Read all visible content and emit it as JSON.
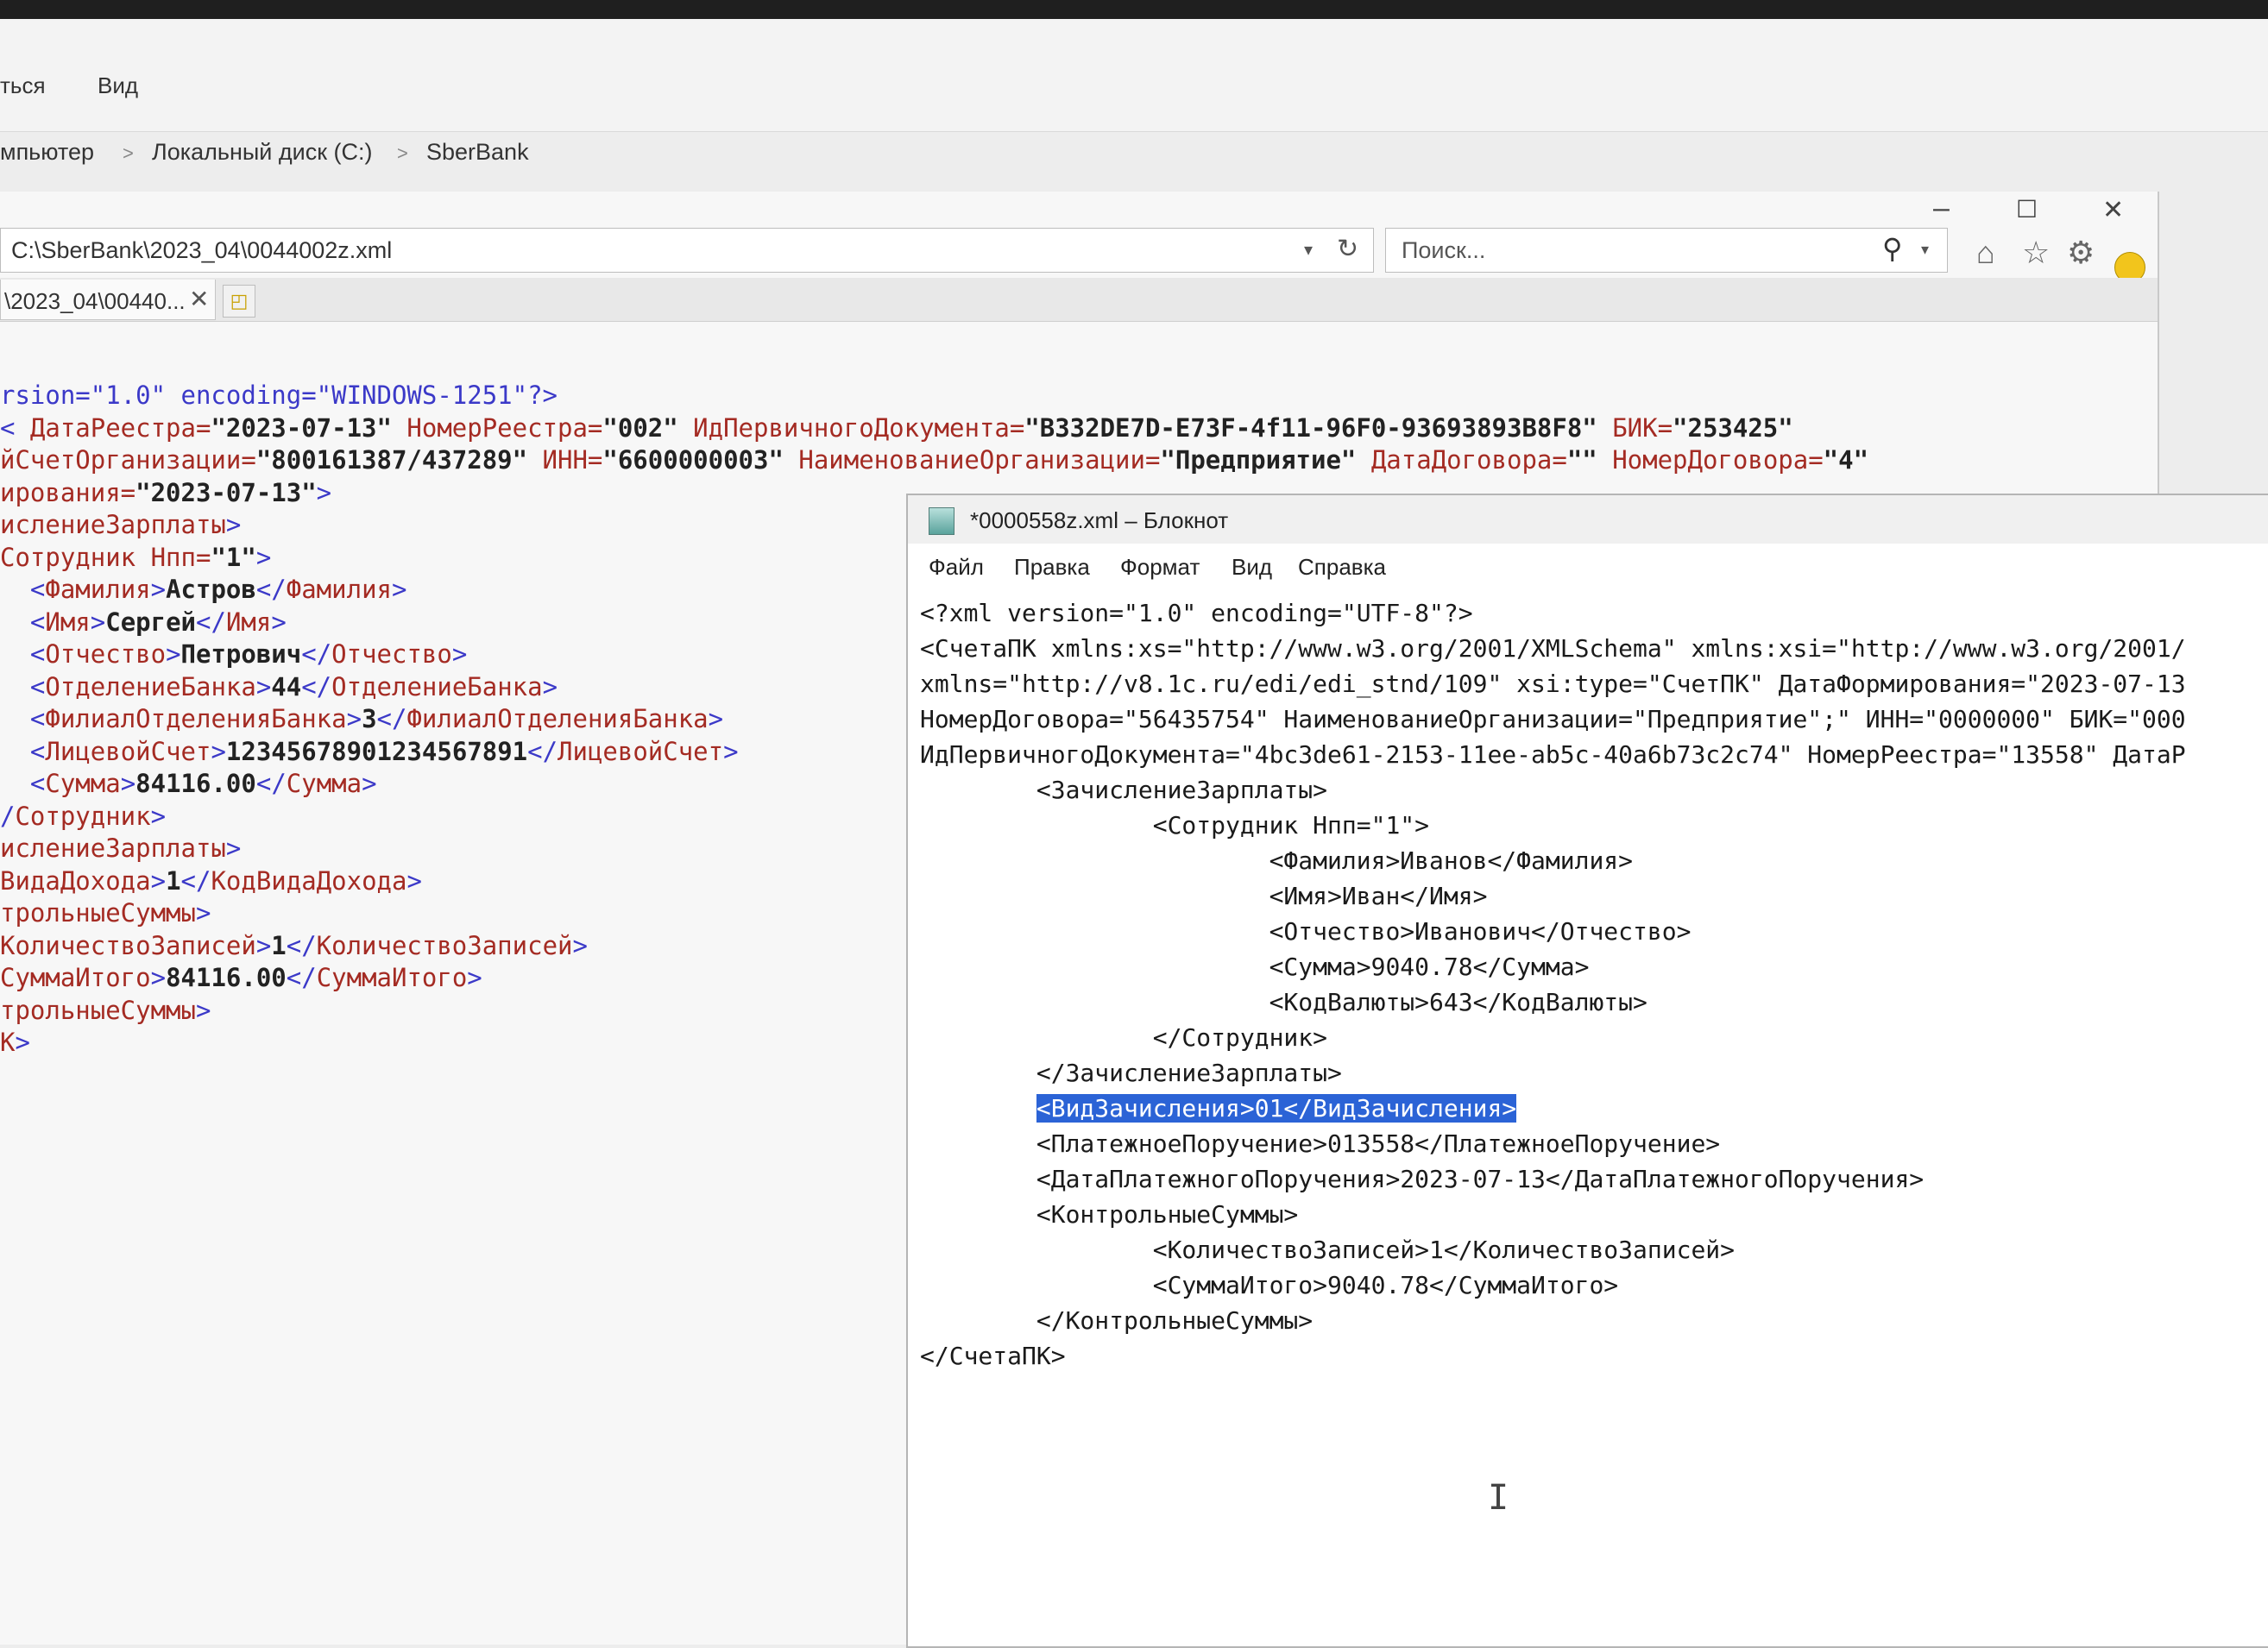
{
  "explorer": {
    "menu": [
      "ться",
      "Вид"
    ],
    "breadcrumb": [
      "мпьютер",
      "Локальный диск (C:)",
      "SberBank"
    ]
  },
  "ie": {
    "address": "C:\\SberBank\\2023_04\\0044002z.xml",
    "search_placeholder": "Поиск...",
    "tab_title": "\\2023_04\\00440...",
    "xml_lines": [
      [
        [
          "bl",
          "rsion=\"1.0\" encoding=\"WINDOWS-1251\"?>"
        ]
      ],
      [
        [
          "bl",
          "< "
        ],
        [
          "br",
          "ДатаРеестра="
        ],
        [
          "bk",
          "\"2023-07-13\" "
        ],
        [
          "br",
          "НомерРеестра="
        ],
        [
          "bk",
          "\"002\" "
        ],
        [
          "br",
          "ИдПервичногоДокумента="
        ],
        [
          "bk",
          "\"B332DE7D-E73F-4f11-96F0-93693893B8F8\" "
        ],
        [
          "br",
          "БИК="
        ],
        [
          "bk",
          "\"253425\""
        ]
      ],
      [
        [
          "br",
          "йСчетОрганизации="
        ],
        [
          "bk",
          "\"800161387/437289\" "
        ],
        [
          "br",
          "ИНН="
        ],
        [
          "bk",
          "\"6600000003\" "
        ],
        [
          "br",
          "НаименованиеОрганизации="
        ],
        [
          "bk",
          "\"Предприятие\" "
        ],
        [
          "br",
          "ДатаДоговора="
        ],
        [
          "bk",
          "\"\" "
        ],
        [
          "br",
          "НомерДоговора="
        ],
        [
          "bk",
          "\"4\""
        ]
      ],
      [
        [
          "br",
          "ирования="
        ],
        [
          "bk",
          "\"2023-07-13\""
        ],
        [
          "bl",
          ">"
        ]
      ],
      [
        [
          "br",
          "исление3арплаты"
        ],
        [
          "bl",
          ">"
        ]
      ],
      [
        [
          "br",
          "Сотрудник Нпп="
        ],
        [
          "bk",
          "\"1\""
        ],
        [
          "bl",
          ">"
        ]
      ],
      [
        [
          "bl",
          "  <"
        ],
        [
          "br",
          "Фамилия"
        ],
        [
          "bl",
          ">"
        ],
        [
          "bk",
          "Астров"
        ],
        [
          "bl",
          "</"
        ],
        [
          "br",
          "Фамилия"
        ],
        [
          "bl",
          ">"
        ]
      ],
      [
        [
          "bl",
          "  <"
        ],
        [
          "br",
          "Имя"
        ],
        [
          "bl",
          ">"
        ],
        [
          "bk",
          "Сергей"
        ],
        [
          "bl",
          "</"
        ],
        [
          "br",
          "Имя"
        ],
        [
          "bl",
          ">"
        ]
      ],
      [
        [
          "bl",
          "  <"
        ],
        [
          "br",
          "Отчество"
        ],
        [
          "bl",
          ">"
        ],
        [
          "bk",
          "Петрович"
        ],
        [
          "bl",
          "</"
        ],
        [
          "br",
          "Отчество"
        ],
        [
          "bl",
          ">"
        ]
      ],
      [
        [
          "bl",
          "  <"
        ],
        [
          "br",
          "ОтделениеБанка"
        ],
        [
          "bl",
          ">"
        ],
        [
          "bk",
          "44"
        ],
        [
          "bl",
          "</"
        ],
        [
          "br",
          "ОтделениеБанка"
        ],
        [
          "bl",
          ">"
        ]
      ],
      [
        [
          "bl",
          "  <"
        ],
        [
          "br",
          "ФилиалОтделенияБанка"
        ],
        [
          "bl",
          ">"
        ],
        [
          "bk",
          "3"
        ],
        [
          "bl",
          "</"
        ],
        [
          "br",
          "ФилиалОтделенияБанка"
        ],
        [
          "bl",
          ">"
        ]
      ],
      [
        [
          "bl",
          "  <"
        ],
        [
          "br",
          "ЛицевойСчет"
        ],
        [
          "bl",
          ">"
        ],
        [
          "bk",
          "12345678901234567891"
        ],
        [
          "bl",
          "</"
        ],
        [
          "br",
          "ЛицевойСчет"
        ],
        [
          "bl",
          ">"
        ]
      ],
      [
        [
          "bl",
          "  <"
        ],
        [
          "br",
          "Сумма"
        ],
        [
          "bl",
          ">"
        ],
        [
          "bk",
          "84116.00"
        ],
        [
          "bl",
          "</"
        ],
        [
          "br",
          "Сумма"
        ],
        [
          "bl",
          ">"
        ]
      ],
      [
        [
          "bl",
          "/"
        ],
        [
          "br",
          "Сотрудник"
        ],
        [
          "bl",
          ">"
        ]
      ],
      [
        [
          "br",
          "исление3арплаты"
        ],
        [
          "bl",
          ">"
        ]
      ],
      [
        [
          "br",
          "ВидаДохода"
        ],
        [
          "bl",
          ">"
        ],
        [
          "bk",
          "1"
        ],
        [
          "bl",
          "</"
        ],
        [
          "br",
          "КодВидаДохода"
        ],
        [
          "bl",
          ">"
        ]
      ],
      [
        [
          "br",
          "трольныеСуммы"
        ],
        [
          "bl",
          ">"
        ]
      ],
      [
        [
          "br",
          "КоличествоЗаписей"
        ],
        [
          "bl",
          ">"
        ],
        [
          "bk",
          "1"
        ],
        [
          "bl",
          "</"
        ],
        [
          "br",
          "КоличествоЗаписей"
        ],
        [
          "bl",
          ">"
        ]
      ],
      [
        [
          "br",
          "СуммаИтого"
        ],
        [
          "bl",
          ">"
        ],
        [
          "bk",
          "84116.00"
        ],
        [
          "bl",
          "</"
        ],
        [
          "br",
          "СуммаИтого"
        ],
        [
          "bl",
          ">"
        ]
      ],
      [
        [
          "br",
          "трольныеСуммы"
        ],
        [
          "bl",
          ">"
        ]
      ],
      [
        [
          "br",
          "К"
        ],
        [
          "bl",
          ">"
        ]
      ]
    ]
  },
  "notepad": {
    "title": "*0000558z.xml – Блокнот",
    "menu": [
      "Файл",
      "Правка",
      "Формат",
      "Вид",
      "Справка"
    ],
    "lines": [
      "<?xml version=\"1.0\" encoding=\"UTF-8\"?>",
      "<СчетаПК xmlns:xs=\"http://www.w3.org/2001/XMLSchema\" xmlns:xsi=\"http://www.w3.org/2001/",
      "xmlns=\"http://v8.1c.ru/edi/edi_stnd/109\" xsi:type=\"СчетПК\" ДатаФормирования=\"2023-07-13",
      "НомерДоговора=\"56435754\" НаименованиеОрганизации=\"Предприятие\";\" ИНН=\"0000000\" БИК=\"000",
      "ИдПервичногоДокумента=\"4bc3de61-2153-11ee-ab5c-40a6b73c2c74\" НомерРеестра=\"13558\" ДатаР",
      "        <ЗачислениеЗарплаты>",
      "                <Сотрудник Нпп=\"1\">",
      "                        <Фамилия>Иванов</Фамилия>",
      "                        <Имя>Иван</Имя>",
      "                        <Отчество>Иванович</Отчество>",
      "                        <Сумма>9040.78</Сумма>",
      "                        <КодВалюты>643</КодВалюты>",
      "                </Сотрудник>",
      "        </ЗачислениеЗарплаты>",
      "        <ВидЗачисления>01</ВидЗачисления>",
      "        <ПлатежноеПоручение>013558</ПлатежноеПоручение>",
      "        <ДатаПлатежногоПоручения>2023-07-13</ДатаПлатежногоПоручения>",
      "        <КонтрольныеСуммы>",
      "                <КоличествоЗаписей>1</КоличествоЗаписей>",
      "                <СуммаИтого>9040.78</СуммаИтого>",
      "        </КонтрольныеСуммы>",
      "</СчетаПК>"
    ],
    "selected_line": 14
  }
}
